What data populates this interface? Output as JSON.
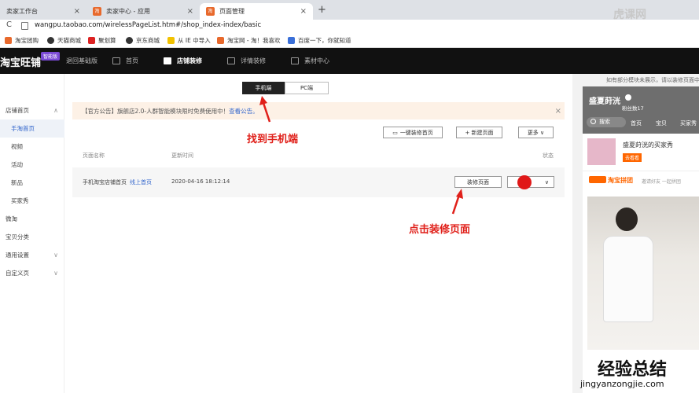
{
  "browser": {
    "tabs": [
      {
        "label": "卖家工作台"
      },
      {
        "label": "卖家中心 - 应用"
      },
      {
        "label": "页面管理"
      }
    ],
    "favicon_text": "淘",
    "new_tab": "+",
    "close": "×",
    "back": "←",
    "reload": "C",
    "url": "wangpu.taobao.com/wirelessPageList.htm#/shop_index-index/basic",
    "bookmarks": [
      "淘宝团购",
      "天猫商城",
      "聚划算",
      "京东商城",
      "从 IE 中导入",
      "淘宝网 - 淘！我喜欢",
      "百度一下，你就知道"
    ]
  },
  "nav": {
    "logo": "淘宝旺铺",
    "badge": "智能版",
    "items": [
      "退回基础版",
      "首页",
      "店铺装修",
      "详情装修",
      "素材中心"
    ]
  },
  "sidebar": {
    "items": [
      {
        "label": "店铺首页"
      },
      {
        "label": "手淘首页"
      },
      {
        "label": "视频"
      },
      {
        "label": "活动"
      },
      {
        "label": "新品"
      },
      {
        "label": "买家秀"
      },
      {
        "label": "微淘"
      },
      {
        "label": "宝贝分类"
      },
      {
        "label": "通用设置"
      },
      {
        "label": "自定义页"
      }
    ]
  },
  "main": {
    "seg_mobile": "手机端",
    "seg_pc": "PC端",
    "notice_text": "【官方公告】旗舰店2.0-人群智能模块限时免费使用中！",
    "notice_link": "查看公告。",
    "btn_one_click": "一键装修首页",
    "btn_new_page": "+ 新建页面",
    "btn_more": "更多 ∨",
    "col_name": "页面名称",
    "col_time": "更新时间",
    "col_status": "状态",
    "row_name": "手机淘宝店铺首页",
    "row_link": "线上首页",
    "row_time": "2020-04-16 18:12:14",
    "btn_decorate": "装修页面",
    "annotation1": "找到手机端",
    "annotation2": "点击装修页面"
  },
  "right": {
    "hint": "如有部分模块未展示，请以装修页面中",
    "shop_name": "盛夏莳洸",
    "fans": "粉丝数17",
    "search": "搜索",
    "tabs": [
      "首页",
      "宝贝",
      "买家秀"
    ],
    "buyer_show": "盛夏莳洸的买家秀",
    "buyer_tag": "去看看",
    "pintuan": "淘宝拼团",
    "pintuan_desc": "邀请好友 一起拼团"
  },
  "watermark": {
    "top": "虎课网",
    "bottom": "经验总结",
    "url": "jingyanzongjie.com"
  },
  "colors": {
    "accent": "#e0201a",
    "link": "#3366cc",
    "nav_bg": "#111111",
    "favicon": "#e8692c"
  }
}
